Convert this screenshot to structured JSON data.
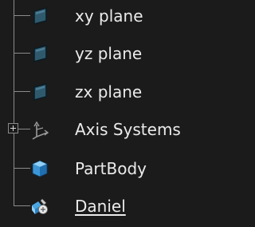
{
  "tree": {
    "items": [
      {
        "label": "xy plane",
        "icon": "plane-icon"
      },
      {
        "label": "yz plane",
        "icon": "plane-icon"
      },
      {
        "label": "zx plane",
        "icon": "plane-icon"
      },
      {
        "label": "Axis Systems",
        "icon": "axis-systems-icon",
        "expander": "collapsed"
      },
      {
        "label": "PartBody",
        "icon": "part-body-icon"
      },
      {
        "label": "Daniel",
        "icon": "sketch-icon"
      }
    ]
  },
  "colors": {
    "background": "#1b1b1b",
    "text": "#ebebeb",
    "tree_lines": "#8a8a8a",
    "plane_icon": "#2f5a6e",
    "part_body_icon": "#4aa6e0"
  }
}
